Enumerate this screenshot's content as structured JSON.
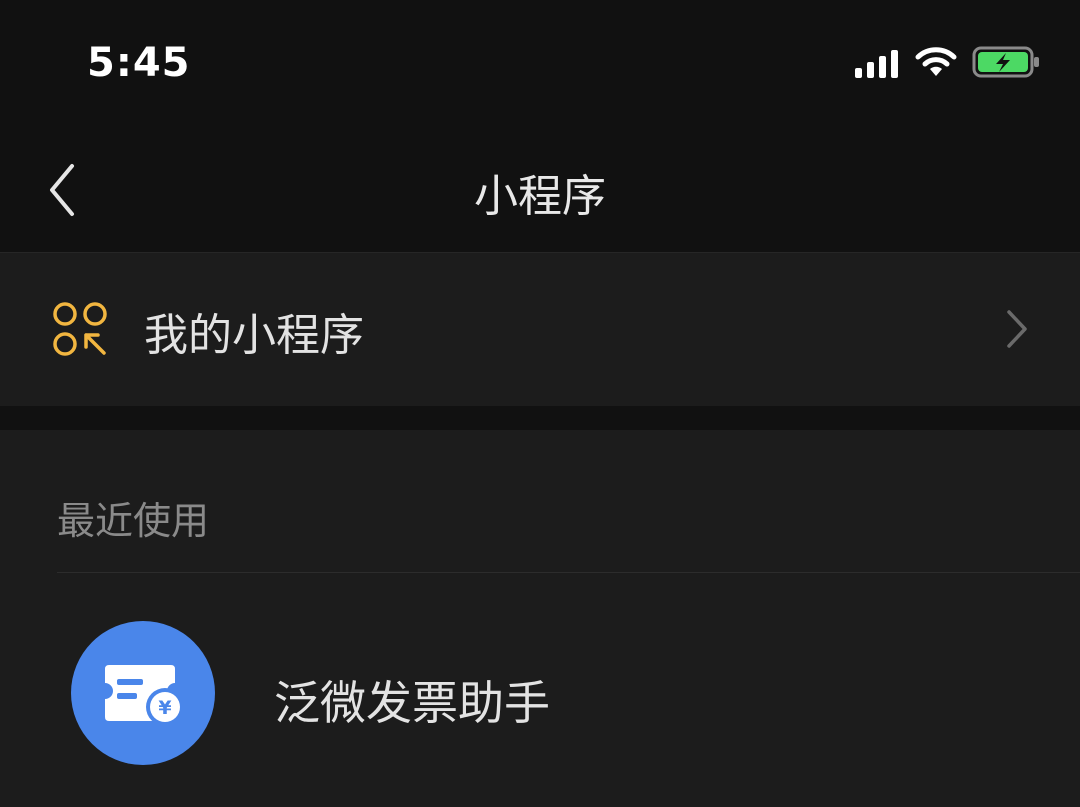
{
  "status_bar": {
    "time": "5:45",
    "icons": [
      "cellular-signal-icon",
      "wifi-icon",
      "battery-charging-icon"
    ],
    "battery_color": "#4cd964"
  },
  "navbar": {
    "title": "小程序",
    "back_icon": "chevron-left-icon"
  },
  "my_mini_programs": {
    "label": "我的小程序",
    "icon": "grid-circles-icon",
    "icon_color": "#f2b640",
    "chevron_icon": "chevron-right-icon"
  },
  "recent": {
    "header": "最近使用",
    "items": [
      {
        "name": "泛微发票助手",
        "icon": "invoice-ticket-icon",
        "icon_bg": "#4a86ea"
      }
    ]
  }
}
